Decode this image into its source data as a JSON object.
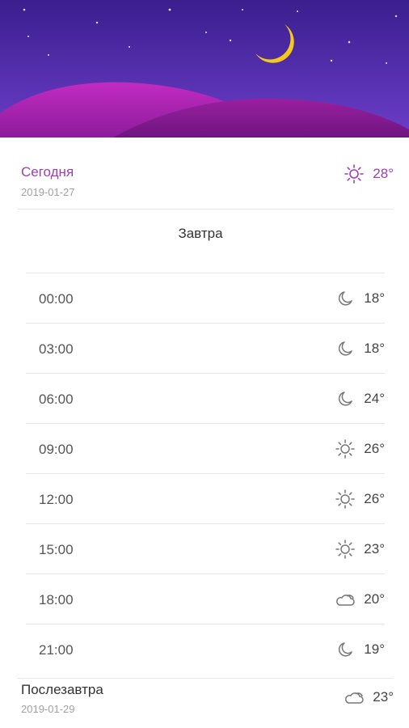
{
  "colors": {
    "accent": "#9c3fb3",
    "sky_top": "#3a1f8f",
    "sky_bottom": "#6a3fc7",
    "hill": "#b023b0",
    "moon": "#f2c81a"
  },
  "today": {
    "label": "Сегодня",
    "date": "2019-01-27",
    "icon": "sun-icon",
    "temp": "28°"
  },
  "tomorrow": {
    "label": "Завтра",
    "hours": [
      {
        "time": "00:00",
        "icon": "moon-icon",
        "temp": "18°"
      },
      {
        "time": "03:00",
        "icon": "moon-icon",
        "temp": "18°"
      },
      {
        "time": "06:00",
        "icon": "moon-icon",
        "temp": "24°"
      },
      {
        "time": "09:00",
        "icon": "sun-icon",
        "temp": "26°"
      },
      {
        "time": "12:00",
        "icon": "sun-icon",
        "temp": "26°"
      },
      {
        "time": "15:00",
        "icon": "sun-icon",
        "temp": "23°"
      },
      {
        "time": "18:00",
        "icon": "cloud-icon",
        "temp": "20°"
      },
      {
        "time": "21:00",
        "icon": "moon-icon",
        "temp": "19°"
      }
    ]
  },
  "day_after": {
    "label": "Послезавтра",
    "date": "2019-01-29",
    "icon": "cloud-icon",
    "temp": "23°"
  }
}
